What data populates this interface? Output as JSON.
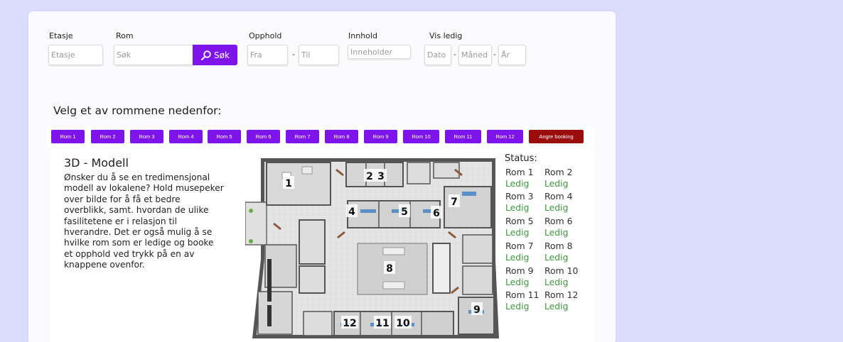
{
  "filters": {
    "floor": {
      "label": "Etasje",
      "placeholder": "Etasje"
    },
    "room": {
      "label": "Rom",
      "placeholder": "Søk",
      "button": "Søk"
    },
    "stay": {
      "label": "Opphold",
      "from_placeholder": "Fra",
      "separator": "-",
      "to_placeholder": "Til"
    },
    "content": {
      "label": "Innhold",
      "placeholder": "Inneholder"
    },
    "available": {
      "label": "Vis ledig",
      "day_placeholder": "Dato",
      "month_placeholder": "Måned",
      "year_placeholder": "År",
      "separator": "-"
    }
  },
  "heading": "Velg et av rommene nedenfor:",
  "room_buttons": [
    "Rom 1",
    "Rom 2",
    "Rom 3",
    "Rom 4",
    "Rom 5",
    "Rom 6",
    "Rom 7",
    "Rom 8",
    "Rom 9",
    "Rom 10",
    "Rom 11",
    "Rom 12"
  ],
  "cancel_button": "Angre booking",
  "model": {
    "title": "3D - Modell",
    "text": "Ønsker du å se en tredimensjonal modell av lokalene? Hold musepeker over bilde for å få et bedre overblikk, samt. hvordan de ulike fasilitetene er i relasjon til hverandre. Det er også mulig å se hvilke rom som er ledige og booke et opphold ved trykk på en av knappene ovenfor."
  },
  "floorplan_labels": [
    "1",
    "2",
    "3",
    "4",
    "5",
    "6",
    "7",
    "8",
    "9",
    "10",
    "11",
    "12"
  ],
  "status": {
    "title": "Status:",
    "rooms": [
      {
        "name": "Rom 1",
        "value": "Ledig"
      },
      {
        "name": "Rom 2",
        "value": "Ledig"
      },
      {
        "name": "Rom 3",
        "value": "Ledig"
      },
      {
        "name": "Rom 4",
        "value": "Ledig"
      },
      {
        "name": "Rom 5",
        "value": "Ledig"
      },
      {
        "name": "Rom 6",
        "value": "Ledig"
      },
      {
        "name": "Rom 7",
        "value": "Ledig"
      },
      {
        "name": "Rom 8",
        "value": "Ledig"
      },
      {
        "name": "Rom 9",
        "value": "Ledig"
      },
      {
        "name": "Rom 10",
        "value": "Ledig"
      },
      {
        "name": "Rom 11",
        "value": "Ledig"
      },
      {
        "name": "Rom 12",
        "value": "Ledig"
      }
    ]
  },
  "colors": {
    "accent": "#7e14ec",
    "danger": "#9b0c0c",
    "available": "#3d9a3d",
    "background": "#dcdcfc"
  }
}
